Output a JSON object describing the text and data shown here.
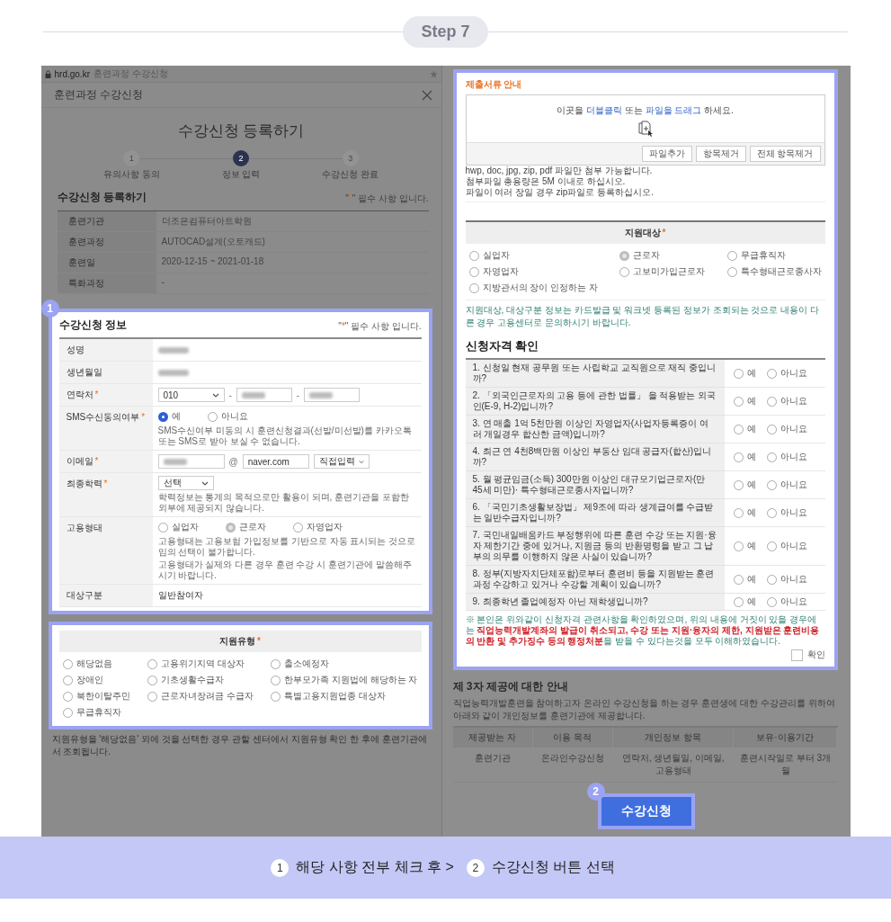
{
  "step": {
    "label": "Step 7"
  },
  "browser": {
    "url": "hrd.go.kr",
    "title": "훈련과정 수강신청"
  },
  "modal": {
    "title": "훈련과정 수강신청",
    "heading": "수강신청 등록하기",
    "steps": [
      {
        "number": "1",
        "label": "유의사항 동의",
        "selected": false
      },
      {
        "number": "2",
        "label": "정보 입력",
        "selected": true
      },
      {
        "number": "3",
        "label": "수강신청 완료",
        "selected": false
      }
    ]
  },
  "registration": {
    "title": "수강신청 등록하기",
    "note": {
      "open": "\"",
      "mark": "*",
      "close": "\" 필수 사항 입니다."
    },
    "rows": [
      {
        "label": "훈련기관",
        "value": "더조은컴퓨터아트학원"
      },
      {
        "label": "훈련과정",
        "value": "AUTOCAD설계(오토캐드)"
      },
      {
        "label": "훈련일",
        "value": "2020-12-15 ~ 2021-01-18"
      },
      {
        "label": "특화과정",
        "value": "-"
      }
    ]
  },
  "application_info": {
    "badge": "1",
    "title": "수강신청 정보",
    "note": {
      "open": "\"",
      "mark": "*",
      "close": "\" 필수 사항 입니다."
    },
    "rows": [
      {
        "kind": "redacted",
        "label": "성명"
      },
      {
        "kind": "redacted",
        "label": "생년월일"
      },
      {
        "kind": "phone",
        "label": "연락처",
        "mark": "*",
        "prefix": "010",
        "separators": [
          "-",
          "-"
        ]
      },
      {
        "kind": "radio",
        "label": "SMS수신동의여부",
        "mark": "*",
        "disabled": false,
        "options": [
          {
            "label": "예",
            "selected": true
          },
          {
            "label": "아니요",
            "selected": false
          }
        ],
        "notes": [
          "SMS수신여부 미동의 시 훈련신청결과(선발/미선발)를 카카오톡 또는 SMS로 받아 보실 수 없습니다."
        ]
      },
      {
        "kind": "email",
        "label": "이메일",
        "mark": "*",
        "separator": "@",
        "domain": "naver.com",
        "domain_select": "직접입력"
      },
      {
        "kind": "select",
        "label": "최종학력",
        "mark": "*",
        "value": "선택",
        "notes": [
          "학력정보는 통계의 목적으로만 활용이 되며, 훈련기관을 포함한 외부에 제공되지 않습니다."
        ]
      },
      {
        "kind": "radio",
        "label": "고용형태",
        "disabled": true,
        "options": [
          {
            "label": "실업자",
            "selected": false
          },
          {
            "label": "근로자",
            "selected": true
          },
          {
            "label": "자영업자",
            "selected": false
          }
        ],
        "notes": [
          "고용형태는 고용보험 가입정보를 기반으로 자동 표시되는 것으로 임의 선택이 불가합니다.",
          "고용형태가 실제와 다른 경우 훈련 수강 시 훈련기관에 말씀해주시기 바랍니다."
        ]
      },
      {
        "kind": "text",
        "label": "대상구분",
        "value": "일반참여자"
      }
    ]
  },
  "support_type": {
    "title": "지원유형",
    "mark": "*",
    "options": [
      {
        "label": "해당없음",
        "selected": false
      },
      {
        "label": "고용위기지역 대상자",
        "selected": false
      },
      {
        "label": "출소예정자",
        "selected": false
      },
      {
        "label": "장애인",
        "selected": false
      },
      {
        "label": "기초생활수급자",
        "selected": false
      },
      {
        "label": "한부모가족 지원법에 해당하는 자",
        "selected": false
      },
      {
        "label": "북한이탈주민",
        "selected": false
      },
      {
        "label": "근로자녀장려금 수급자",
        "selected": false
      },
      {
        "label": "특별고용지원업종 대상자",
        "selected": false
      },
      {
        "label": "무급휴직자",
        "selected": false
      }
    ],
    "note": "지원유형을 '해당없음' 외에 것을 선택한 경우 관할 센터에서 지원유형 확인 한 후에 훈련기관에서 조회됩니다."
  },
  "documents": {
    "title": "제출서류 안내",
    "drop_hint": [
      {
        "text": "이곳을 ",
        "emphasis": false
      },
      {
        "text": "더블클릭",
        "emphasis": true
      },
      {
        "text": " 또는 ",
        "emphasis": false
      },
      {
        "text": "파일을 드래그",
        "emphasis": true
      },
      {
        "text": " 하세요.",
        "emphasis": false
      }
    ],
    "buttons": [
      "파일추가",
      "항목제거",
      "전체 항목제거"
    ],
    "notes": [
      "hwp, doc, jpg, zip, pdf 파일만 첨부 가능합니다.",
      "첨부파일 총용량은 5M 이내로 하십시오.",
      "파일이 여러 장일 경우 zip파일로 등록하십시오."
    ]
  },
  "support_target": {
    "title": "지원대상",
    "mark": "*",
    "disabled": true,
    "options": [
      {
        "label": "실업자",
        "selected": false
      },
      {
        "label": "근로자",
        "selected": true
      },
      {
        "label": "무급휴직자",
        "selected": false
      },
      {
        "label": "자영업자",
        "selected": false
      },
      {
        "label": "고보미가입근로자",
        "selected": false
      },
      {
        "label": "특수형태근로종사자",
        "selected": false
      },
      {
        "label": "지방관서의 장이 인정하는 자",
        "selected": false
      }
    ],
    "note": "지원대상, 대상구분 정보는 카드발급 및 워크넷 등록된 정보가 조회되는 것으로 내용이 다른 경우 고용센터로 문의하시기 바랍니다."
  },
  "eligibility": {
    "title": "신청자격 확인",
    "questions": [
      {
        "text": "1. 신청일 현재 공무원 또는 사립학교 교직원으로 재직 중입니까?",
        "options": [
          {
            "label": "예",
            "selected": false
          },
          {
            "label": "아니요",
            "selected": false
          }
        ]
      },
      {
        "text": "2. 「외국인근로자의 고용 등에 관한 법률」 을 적용받는 외국인(E-9, H-2)입니까?",
        "options": [
          {
            "label": "예",
            "selected": false
          },
          {
            "label": "아니요",
            "selected": false
          }
        ]
      },
      {
        "text": "3. 연 매출 1억 5천만원 이상인 자영업자(사업자등록증이 여러 개일경우 합산한 금액)입니까?",
        "options": [
          {
            "label": "예",
            "selected": false
          },
          {
            "label": "아니요",
            "selected": false
          }
        ]
      },
      {
        "text": "4. 최근 연 4천8백만원 이상인 부동산 임대 공급자(합산)입니까?",
        "options": [
          {
            "label": "예",
            "selected": false
          },
          {
            "label": "아니요",
            "selected": false
          }
        ]
      },
      {
        "text": "5. 월 평균임금(소득) 300만원 이상인 대규모기업근로자(만 45세 미만)· 특수형태근로종사자입니까?",
        "options": [
          {
            "label": "예",
            "selected": false
          },
          {
            "label": "아니요",
            "selected": false
          }
        ]
      },
      {
        "text": "6. 「국민기초생활보장법」 제9조에 따라 생계급여를 수급받는 일반수급자입니까?",
        "options": [
          {
            "label": "예",
            "selected": false
          },
          {
            "label": "아니요",
            "selected": false
          }
        ]
      },
      {
        "text": "7. 국민내일배움카드 부정행위에 따른 훈련 수강 또는 지원·융자 제한기간 중에 있거나, 지원금 등의 반환명령을 받고 그 납부의 의무를 이행하지 않은 사실이 있습니까?",
        "options": [
          {
            "label": "예",
            "selected": false
          },
          {
            "label": "아니요",
            "selected": false
          }
        ]
      },
      {
        "text": "8. 정부(지방자치단체포함)로부터 훈련비 등을 지원받는 훈련과정 수강하고 있거나 수강할 계획이 있습니까?",
        "options": [
          {
            "label": "예",
            "selected": false
          },
          {
            "label": "아니요",
            "selected": false
          }
        ]
      },
      {
        "text": "9. 최종학년 졸업예정자 아닌 재학생입니까?",
        "options": [
          {
            "label": "예",
            "selected": false
          },
          {
            "label": "아니요",
            "selected": false
          }
        ]
      }
    ],
    "notice": "※ 본인은 위와같이 신청자격 관련사항을 확인하였으며, 위의 내용에 거짓이 있을 경우에는 **직업능력개발계좌의 발급이 취소되고, 수강 또는 지원·융자의 제한, 지원받은 훈련비용의 반환 및 추가징수 등의 행정처분**을 받을 수 있다는것을 모두 이해하였습니다.",
    "confirm": {
      "label": "확인",
      "checked": false
    }
  },
  "third_party": {
    "title": "제 3자 제공에 대한 안내",
    "description": "직업능력개발훈련을 참여하고자 온라인 수강신청을 하는 경우 훈련생에 대한 수강관리를 위하여 아래와 같이 개인정보를 훈련기관에 제공합니다.",
    "columns": [
      "제공받는 자",
      "이용 목적",
      "개인정보 항목",
      "보유·이용기간"
    ],
    "rows": [
      [
        "훈련기관",
        "온라인수강신청",
        "연락처, 생년월일, 이메일, 고용형태",
        "훈련시작일로 부터 3개월"
      ]
    ]
  },
  "submit": {
    "badge": "2",
    "label": "수강신청"
  },
  "banner": {
    "items": [
      {
        "badge": "1",
        "text": "해당 사항 전부 체크 후 >"
      },
      {
        "badge": "2",
        "text": "수강신청 버튼 선택"
      }
    ]
  }
}
